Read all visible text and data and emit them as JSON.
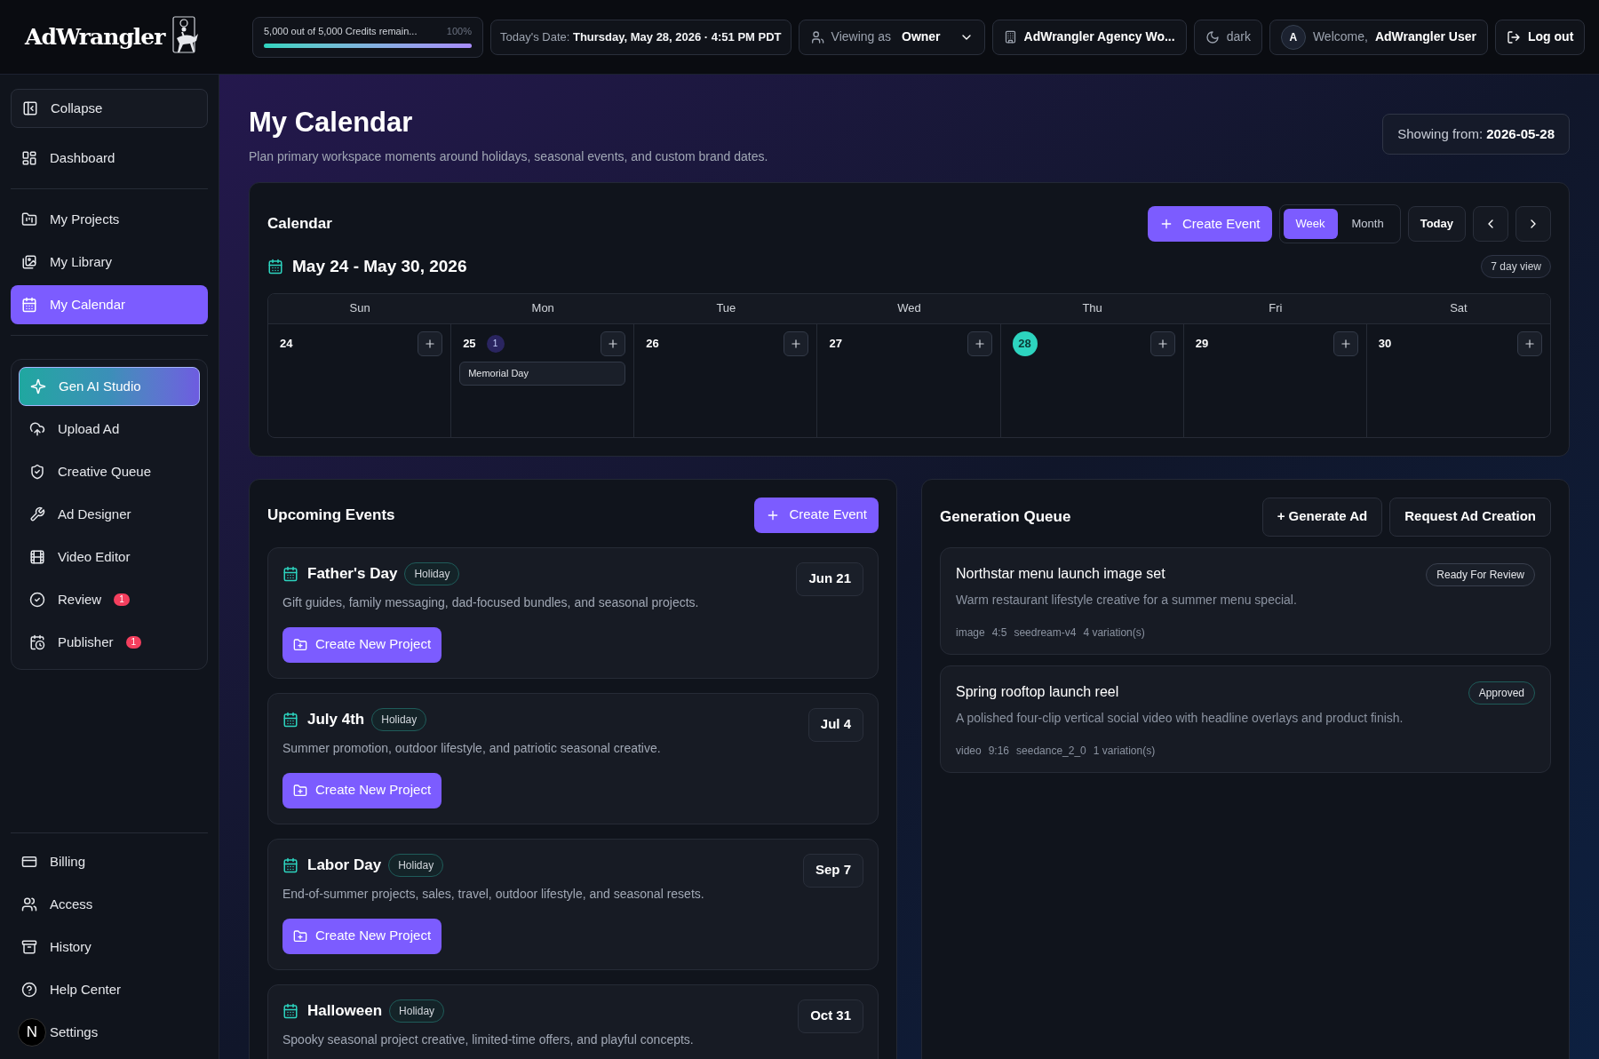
{
  "topbar": {
    "logo": "AdWrangler",
    "credits": {
      "text": "5,000 out of 5,000 Credits remain...",
      "percent": "100%",
      "level": 1
    },
    "date": {
      "label": "Today's Date:",
      "value": "Thursday, May 28, 2026 · 4:51 PM PDT"
    },
    "viewing": {
      "label": "Viewing as",
      "value": "Owner"
    },
    "workspace": "AdWrangler Agency Wo...",
    "theme": "dark",
    "welcome": {
      "avatar": "A",
      "label": "Welcome,",
      "name": "AdWrangler User"
    },
    "logout": "Log out"
  },
  "sidebar": {
    "collapse": "Collapse",
    "groups": [
      {
        "items": [
          {
            "label": "Dashboard",
            "selected": false
          }
        ]
      },
      {
        "items": [
          {
            "label": "My Projects",
            "selected": false
          },
          {
            "label": "My Library",
            "selected": false
          },
          {
            "label": "My Calendar",
            "selected": true
          }
        ]
      }
    ],
    "tools": [
      {
        "label": "Gen AI Studio",
        "kind": "featured"
      },
      {
        "label": "Upload Ad",
        "kind": "link"
      },
      {
        "label": "Creative Queue",
        "kind": "link"
      },
      {
        "label": "Ad Designer",
        "kind": "link"
      },
      {
        "label": "Video Editor",
        "kind": "link"
      },
      {
        "label": "Review",
        "kind": "link",
        "badge": "1"
      },
      {
        "label": "Publisher",
        "kind": "link",
        "badge": "1"
      }
    ],
    "bottom": [
      {
        "label": "Billing"
      },
      {
        "label": "Access"
      },
      {
        "label": "History"
      },
      {
        "label": "Help Center"
      },
      {
        "label": "Settings"
      }
    ],
    "dev_badge": "N"
  },
  "page": {
    "title": "My Calendar",
    "subtitle": "Plan primary workspace moments around holidays, seasonal events, and custom brand dates.",
    "showing": {
      "label": "Showing from:",
      "value": "2026-05-28"
    }
  },
  "calendar": {
    "title": "Calendar",
    "create": "Create Event",
    "views": [
      {
        "label": "Week",
        "selected": true
      },
      {
        "label": "Month",
        "selected": false
      }
    ],
    "today": "Today",
    "range": "May 24 - May 30, 2026",
    "view_badge": "7 day view",
    "days": [
      {
        "weekday": "Sun",
        "date": "24",
        "today": false
      },
      {
        "weekday": "Mon",
        "date": "25",
        "today": false,
        "count": "1",
        "events": [
          "Memorial Day"
        ]
      },
      {
        "weekday": "Tue",
        "date": "26",
        "today": false
      },
      {
        "weekday": "Wed",
        "date": "27",
        "today": false
      },
      {
        "weekday": "Thu",
        "date": "28",
        "today": true
      },
      {
        "weekday": "Fri",
        "date": "29",
        "today": false
      },
      {
        "weekday": "Sat",
        "date": "30",
        "today": false
      }
    ]
  },
  "upcoming": {
    "title": "Upcoming Events",
    "create": "Create Event",
    "events": [
      {
        "title": "Father's Day",
        "tag": "Holiday",
        "description": "Gift guides, family messaging, dad-focused bundles, and seasonal projects.",
        "date": "Jun 21",
        "button": "Create New Project"
      },
      {
        "title": "July 4th",
        "tag": "Holiday",
        "description": "Summer promotion, outdoor lifestyle, and patriotic seasonal creative.",
        "date": "Jul 4",
        "button": "Create New Project"
      },
      {
        "title": "Labor Day",
        "tag": "Holiday",
        "description": "End-of-summer projects, sales, travel, outdoor lifestyle, and seasonal resets.",
        "date": "Sep 7",
        "button": "Create New Project"
      },
      {
        "title": "Halloween",
        "tag": "Holiday",
        "description": "Spooky seasonal project creative, limited-time offers, and playful concepts.",
        "date": "Oct 31"
      }
    ]
  },
  "queue": {
    "title": "Generation Queue",
    "buttons": [
      "+ Generate Ad",
      "Request Ad Creation"
    ],
    "items": [
      {
        "title": "Northstar menu launch image set",
        "description": "Warm restaurant lifestyle creative for a summer menu special.",
        "meta": [
          "image",
          "4:5",
          "seedream-v4",
          "4 variation(s)"
        ],
        "status": "Ready For Review",
        "color": "#3a404e"
      },
      {
        "title": "Spring rooftop launch reel",
        "description": "A polished four-clip vertical social video with headline overlays and product finish.",
        "meta": [
          "video",
          "9:16",
          "seedance_2_0",
          "1 variation(s)"
        ],
        "status": "Approved",
        "color": "#1f5c5a"
      }
    ]
  }
}
